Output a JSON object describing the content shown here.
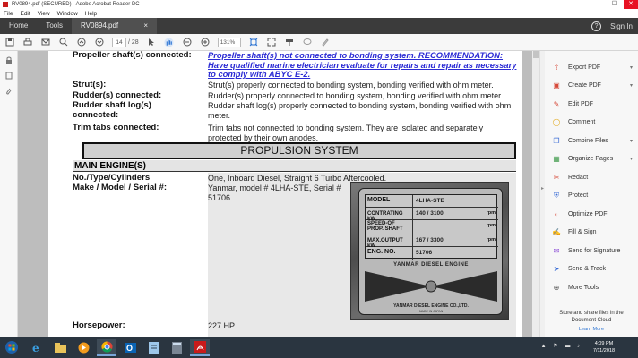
{
  "window": {
    "title": "RV0894.pdf (SECURED) - Adobe Acrobat Reader DC",
    "minimize": "—",
    "maximize": "☐",
    "close": "✕"
  },
  "menu": [
    "File",
    "Edit",
    "View",
    "Window",
    "Help"
  ],
  "tabs": {
    "home": "Home",
    "tools": "Tools",
    "doc": "RV0894.pdf (SECUR...",
    "doc_close": "×",
    "help": "?",
    "sign_in": "Sign In"
  },
  "toolbar": {
    "page_current": "14",
    "page_total": "/ 28",
    "zoom": "131%",
    "icons": [
      "save-icon",
      "print-icon",
      "email-icon",
      "search-icon",
      "prev-page-icon",
      "next-page-icon",
      "select-cursor-icon",
      "hand-icon",
      "zoom-out-icon",
      "zoom-in-icon",
      "fit-page-icon",
      "full-screen-icon",
      "keyboard-icon",
      "comment-icon",
      "sign-icon"
    ]
  },
  "document": {
    "rows": [
      {
        "label": "Propeller shaft(s) connected:",
        "value": "Propeller shaft(s) not connected to bonding system. RECOMMENDATION: Have qualified marine electrician evaluate for repairs and repair as necessary to comply with ABYC E-2."
      },
      {
        "label": "Strut(s):",
        "value": "Strut(s) properly connected to bonding system, bonding verified with ohm meter."
      },
      {
        "label": "Rudder(s) connected:",
        "value": "Rudder(s) properly connected to bonding system, bonding verified with ohm meter."
      },
      {
        "label": "Rudder shaft log(s) connected:",
        "value": "Rudder shaft log(s) properly connected to bonding system, bonding verified with ohm meter."
      },
      {
        "label": "Trim tabs connected:",
        "value": "Trim tabs not connected to bonding system. They are isolated and  separately protected by their own anodes."
      }
    ],
    "section_title": "PROPULSION SYSTEM",
    "subsection_title": "MAIN ENGINE(S)",
    "engine_rows": [
      {
        "label": "No./Type/Cylinders",
        "value": "One, Inboard Diesel, Straight 6 Turbo Aftercooled."
      },
      {
        "label": "Make / Model / Serial #:",
        "value": "Yanmar, model # 4LHA-STE, Serial # 51706."
      },
      {
        "label": "Horsepower:",
        "value": "227 HP."
      }
    ],
    "plate": {
      "model_label": "MODEL",
      "model_value": "4LHA-STE",
      "cont_label": "CONTRATING kW",
      "cont_value": "140 / 3100",
      "cont_unit": "rpm",
      "speed_label": "SPEED-OF PROP. SHAFT",
      "speed_unit": "rpm",
      "max_label": "MAX.OUTPUT kW",
      "max_value": "167 / 3300",
      "max_unit": "rpm",
      "eng_label": "ENG. NO.",
      "eng_value": "51706",
      "maker": "YANMAR DIESEL ENGINE",
      "company": "YANMAR DIESEL ENGINE CO.,LTD.",
      "origin": "MADE IN JAPAN"
    }
  },
  "right_pane": {
    "tools": [
      {
        "label": "Export PDF",
        "icon": "export-pdf-icon",
        "color": "#d64a3a",
        "glyph": "⇪",
        "expand": true
      },
      {
        "label": "Create PDF",
        "icon": "create-pdf-icon",
        "color": "#d64a3a",
        "glyph": "▣",
        "expand": true
      },
      {
        "label": "Edit PDF",
        "icon": "edit-pdf-icon",
        "color": "#d64a3a",
        "glyph": "✎",
        "expand": false
      },
      {
        "label": "Comment",
        "icon": "comment-icon",
        "color": "#e2a91b",
        "glyph": "◯",
        "expand": false
      },
      {
        "label": "Combine Files",
        "icon": "combine-files-icon",
        "color": "#3c6ed6",
        "glyph": "❐",
        "expand": true
      },
      {
        "label": "Organize Pages",
        "icon": "organize-pages-icon",
        "color": "#3e9a4a",
        "glyph": "▦",
        "expand": true
      },
      {
        "label": "Redact",
        "icon": "redact-icon",
        "color": "#d64a3a",
        "glyph": "✂",
        "expand": false
      },
      {
        "label": "Protect",
        "icon": "protect-icon",
        "color": "#3c6ed6",
        "glyph": "⛨",
        "expand": false
      },
      {
        "label": "Optimize PDF",
        "icon": "optimize-pdf-icon",
        "color": "#d64a3a",
        "glyph": "◐",
        "expand": false
      },
      {
        "label": "Fill & Sign",
        "icon": "fill-sign-icon",
        "color": "#8b4bd6",
        "glyph": "✍",
        "expand": false
      },
      {
        "label": "Send for Signature",
        "icon": "send-signature-icon",
        "color": "#8b4bd6",
        "glyph": "✉",
        "expand": false
      },
      {
        "label": "Send & Track",
        "icon": "send-track-icon",
        "color": "#3c6ed6",
        "glyph": "➤",
        "expand": false
      },
      {
        "label": "More Tools",
        "icon": "more-tools-icon",
        "color": "#555555",
        "glyph": "⊕",
        "expand": false
      }
    ],
    "cloud_text": "Store and share files in the Document Cloud",
    "learn_more": "Learn More"
  },
  "taskbar": {
    "time": "4:09 PM",
    "date": "7/11/2018",
    "apps": [
      "ie-icon",
      "explorer-icon",
      "media-player-icon",
      "chrome-icon",
      "outlook-icon",
      "notepad-icon",
      "calculator-icon",
      "acrobat-icon"
    ]
  }
}
